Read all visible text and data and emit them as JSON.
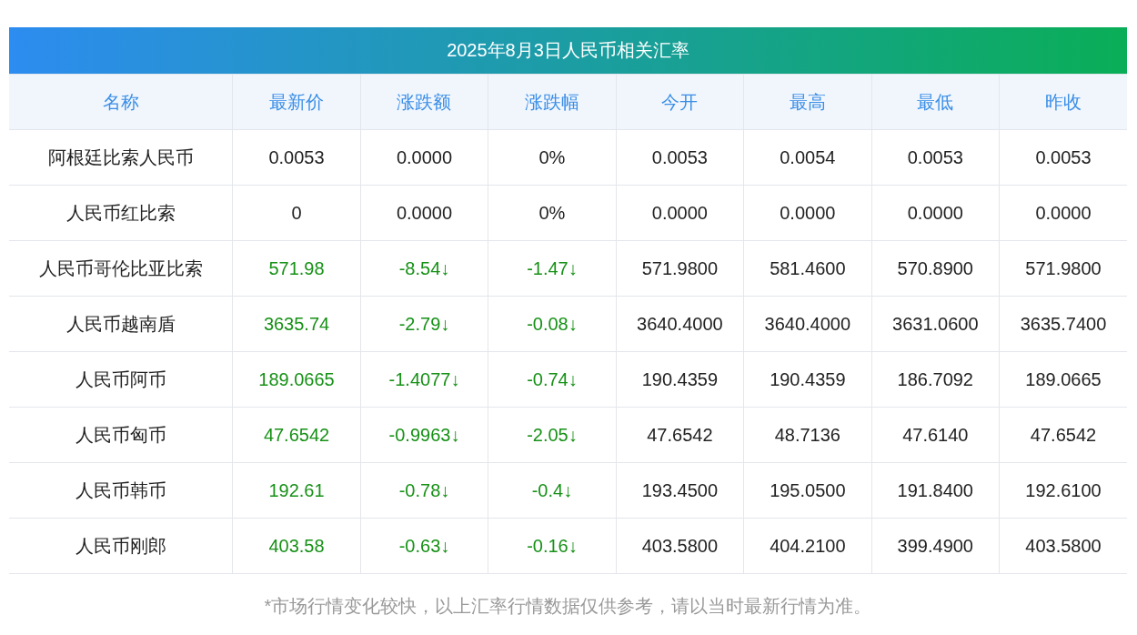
{
  "title": "2025年8月3日人民币相关汇率",
  "table": {
    "columns": [
      "名称",
      "最新价",
      "涨跌额",
      "涨跌幅",
      "今开",
      "最高",
      "最低",
      "昨收"
    ],
    "rows": [
      {
        "kind": "flat",
        "cells": [
          "阿根廷比索人民币",
          "0.0053",
          "0.0000",
          "0%",
          "0.0053",
          "0.0054",
          "0.0053",
          "0.0053"
        ]
      },
      {
        "kind": "flat",
        "cells": [
          "人民币红比索",
          "0",
          "0.0000",
          "0%",
          "0.0000",
          "0.0000",
          "0.0000",
          "0.0000"
        ]
      },
      {
        "kind": "down",
        "cells": [
          "人民币哥伦比亚比索",
          "571.98",
          "-8.54↓",
          "-1.47↓",
          "571.9800",
          "581.4600",
          "570.8900",
          "571.9800"
        ]
      },
      {
        "kind": "down",
        "cells": [
          "人民币越南盾",
          "3635.74",
          "-2.79↓",
          "-0.08↓",
          "3640.4000",
          "3640.4000",
          "3631.0600",
          "3635.7400"
        ]
      },
      {
        "kind": "down",
        "cells": [
          "人民币阿币",
          "189.0665",
          "-1.4077↓",
          "-0.74↓",
          "190.4359",
          "190.4359",
          "186.7092",
          "189.0665"
        ]
      },
      {
        "kind": "down",
        "cells": [
          "人民币匈币",
          "47.6542",
          "-0.9963↓",
          "-2.05↓",
          "47.6542",
          "48.7136",
          "47.6140",
          "47.6542"
        ]
      },
      {
        "kind": "down",
        "cells": [
          "人民币韩币",
          "192.61",
          "-0.78↓",
          "-0.4↓",
          "193.4500",
          "195.0500",
          "191.8400",
          "192.6100"
        ]
      },
      {
        "kind": "down",
        "cells": [
          "人民币刚郎",
          "403.58",
          "-0.63↓",
          "-0.16↓",
          "403.5800",
          "404.2100",
          "399.4900",
          "403.5800"
        ]
      }
    ]
  },
  "footnote": "*市场行情变化较快，以上汇率行情数据仅供参考，请以当时最新行情为准。"
}
